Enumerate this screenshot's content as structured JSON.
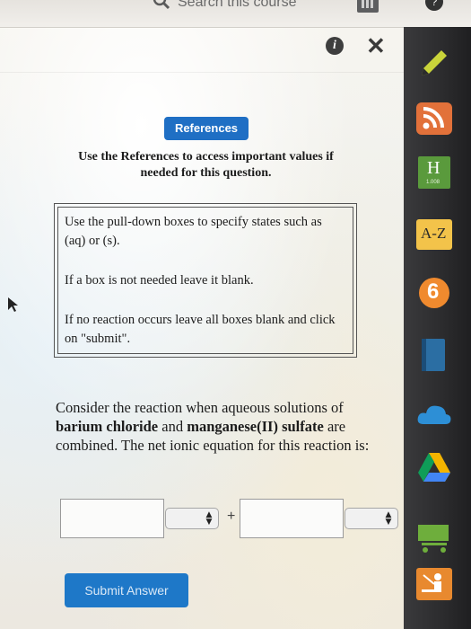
{
  "search": {
    "text": "Search this course"
  },
  "dialog": {
    "references_label": "References",
    "references_note": "Use the References to access important values if needed for this question.",
    "instructions": [
      "Use the pull-down boxes to specify states such as (aq) or (s).",
      "If a box is not needed leave it blank.",
      "If no reaction occurs leave all boxes blank and click on \"submit\"."
    ],
    "question": {
      "part1": "Consider the reaction when aqueous solutions of ",
      "reactant1": "barium chloride",
      "part2": " and ",
      "reactant2": "manganese(II) sulfate",
      "part3": " are combined. The net ionic equation for this reaction is:"
    },
    "equation": {
      "species1_value": "",
      "state1_value": "",
      "plus": "+",
      "species2_value": "",
      "state2_value": ""
    },
    "submit_label": "Submit Answer"
  },
  "dock": {
    "items": [
      {
        "icon": "pencil-icon",
        "color": "#c9d43a"
      },
      {
        "icon": "rss-icon",
        "color": "#e2713a"
      },
      {
        "icon": "periodic-table-icon",
        "color": "#5a9a3c",
        "label": "H",
        "sublabel": "1.008"
      },
      {
        "icon": "glossary-icon",
        "color": "#f3c34a",
        "label": "A-Z"
      },
      {
        "icon": "six-icon",
        "color": "#f08a2e",
        "label": "6"
      },
      {
        "icon": "book-icon",
        "color": "#2b6ea3"
      },
      {
        "icon": "cloud-icon",
        "color": "#2d8fd6"
      },
      {
        "icon": "drive-icon",
        "color": "#f4b400"
      },
      {
        "icon": "cart-icon",
        "color": "#6eae3c"
      },
      {
        "icon": "teacher-icon",
        "color": "#e8892f"
      }
    ]
  }
}
